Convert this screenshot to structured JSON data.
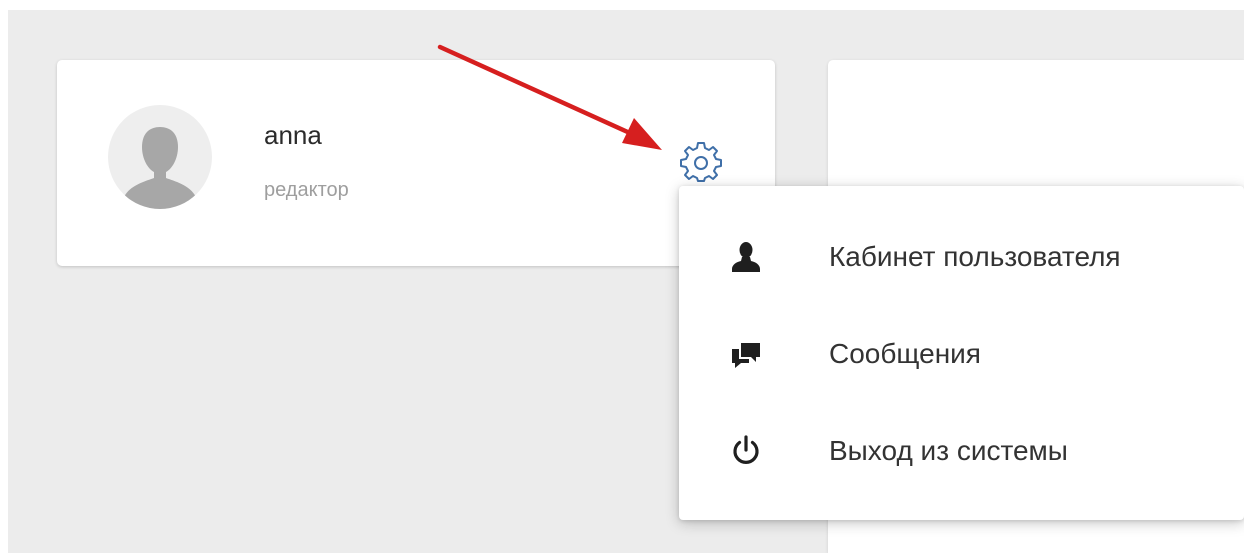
{
  "user": {
    "name": "anna",
    "role": "редактор"
  },
  "settings_icon": "gear-icon",
  "menu": {
    "items": [
      {
        "label": "Кабинет пользователя",
        "icon": "user-icon"
      },
      {
        "label": "Сообщения",
        "icon": "messages-icon"
      },
      {
        "label": "Выход из системы",
        "icon": "power-icon"
      }
    ]
  },
  "colors": {
    "background": "#ececec",
    "card": "#ffffff",
    "gear": "#3f6fa8",
    "annotation_arrow": "#d61f1f",
    "menu_text": "#333333",
    "role_text": "#9e9e9e"
  }
}
